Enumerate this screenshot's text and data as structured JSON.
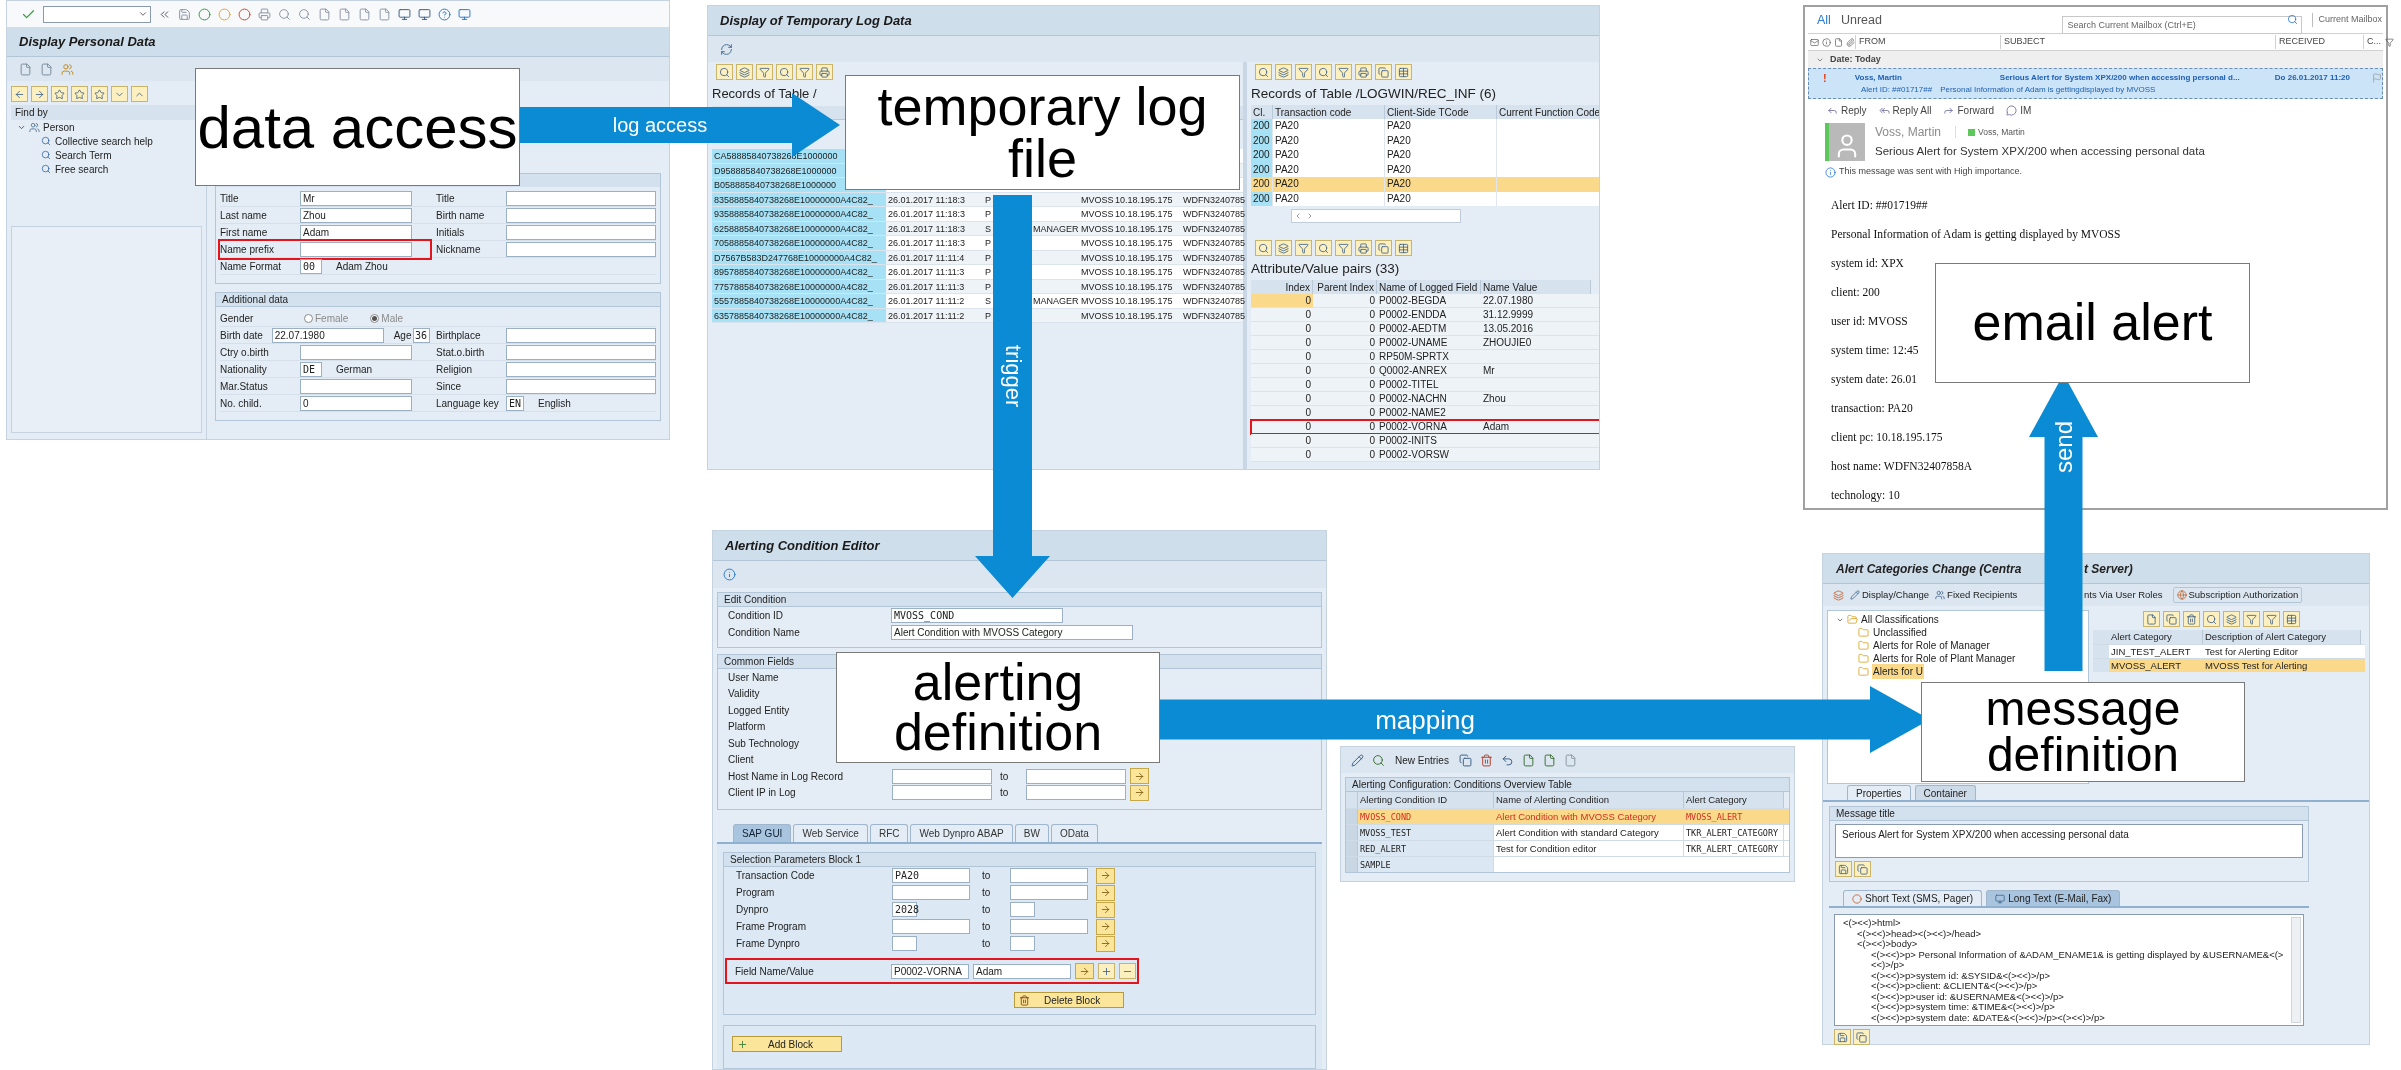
{
  "personal_data": {
    "title": "Display Personal Data",
    "find_by": "Find by",
    "tree": [
      {
        "label": "Person",
        "expanded": true,
        "children": [
          {
            "label": "Collective search help"
          },
          {
            "label": "Search Term"
          },
          {
            "label": "Free search"
          }
        ]
      }
    ],
    "name_rows": [
      {
        "left": {
          "label": "Title",
          "value": "Mr"
        },
        "right": {
          "label": "Title"
        },
        "marked": false
      },
      {
        "left": {
          "label": "Last name",
          "value": "Zhou"
        },
        "right": {
          "label": "Birth name"
        },
        "marked": false
      },
      {
        "left": {
          "label": "First name",
          "value": "Adam"
        },
        "right": {
          "label": "Initials"
        },
        "marked": false
      },
      {
        "left": {
          "label": "Name prefix"
        },
        "right": {
          "label": "Nickname"
        },
        "marked": true
      },
      {
        "left": {
          "label": "Name Format",
          "value": "00",
          "text": "Adam Zhou"
        },
        "marked": false
      }
    ],
    "additional_title": "Additional data",
    "additional_rows": [
      {
        "left": {
          "label": "Gender",
          "radios": [
            {
              "label": "Female",
              "selected": false
            },
            {
              "label": "Male",
              "selected": true
            }
          ]
        }
      },
      {
        "left": {
          "label": "Birth date",
          "value": "22.07.1980"
        },
        "extra": {
          "label": "Age",
          "value": "36"
        },
        "right": {
          "label": "Birthplace"
        }
      },
      {
        "left": {
          "label": "Ctry o.birth"
        },
        "right": {
          "label": "Stat.o.birth"
        }
      },
      {
        "left": {
          "label": "Nationality",
          "value": "DE",
          "text": "German"
        },
        "right": {
          "label": "Religion"
        }
      },
      {
        "left": {
          "label": "Mar.Status"
        },
        "right": {
          "label": "Since"
        }
      },
      {
        "left": {
          "label": "No. child.",
          "value": "0"
        },
        "right": {
          "label": "Language key",
          "value": "EN",
          "text": "English"
        }
      }
    ]
  },
  "log_data": {
    "title": "Display of Temporary Log Data",
    "records_title": "Records of Table /",
    "records": [
      {
        "column_1": "CA58885840738268E1000000"
      },
      {
        "column_1": "D958885840738268E1000000"
      },
      {
        "column_1": "B058885840738268E1000000"
      },
      {
        "column_1": "8358885840738268E10000000A4C82_",
        "column_2": "26.01.2017 11:18:3",
        "column_3": "P",
        "column_5": "MVOSS",
        "column_6": "10.18.195.175",
        "column_7": "WDFN3240785"
      },
      {
        "column_1": "9358885840738268E10000000A4C82_",
        "column_2": "26.01.2017 11:18:3",
        "column_3": "P",
        "column_5": "MVOSS",
        "column_6": "10.18.195.175",
        "column_7": "WDFN3240785"
      },
      {
        "column_1": "6258885840738268E10000000A4C82_",
        "column_2": "26.01.2017 11:18:3",
        "column_3": "S",
        "column_4": "MANAGER",
        "column_5": "MVOSS",
        "column_6": "10.18.195.175",
        "column_7": "WDFN3240785"
      },
      {
        "column_1": "7058885840738268E10000000A4C82_",
        "column_2": "26.01.2017 11:18:3",
        "column_3": "P",
        "column_5": "MVOSS",
        "column_6": "10.18.195.175",
        "column_7": "WDFN3240785"
      },
      {
        "column_1": "D7567B583D247768E10000000A4C82_",
        "column_2": "26.01.2017 11:11:4",
        "column_3": "P",
        "column_5": "MVOSS",
        "column_6": "10.18.195.175",
        "column_7": "WDFN3240785"
      },
      {
        "column_1": "8957885840738268E10000000A4C82_",
        "column_2": "26.01.2017 11:11:3",
        "column_3": "P",
        "column_5": "MVOSS",
        "column_6": "10.18.195.175",
        "column_7": "WDFN3240785"
      },
      {
        "column_1": "7757885840738268E10000000A4C82_",
        "column_2": "26.01.2017 11:11:3",
        "column_3": "P",
        "column_5": "MVOSS",
        "column_6": "10.18.195.175",
        "column_7": "WDFN3240785"
      },
      {
        "column_1": "5557885840738268E10000000A4C82_",
        "column_2": "26.01.2017 11:11:2",
        "column_3": "S",
        "column_4": "MANAGER",
        "column_5": "MVOSS",
        "column_6": "10.18.195.175",
        "column_7": "WDFN3240785"
      },
      {
        "column_1": "6357885840738268E10000000A4C82_",
        "column_2": "26.01.2017 11:11:2",
        "column_3": "P",
        "column_5": "MVOSS",
        "column_6": "10.18.195.175",
        "column_7": "WDFN3240785"
      }
    ],
    "inf_title": "Records of Table /LOGWIN/REC_INF (6)",
    "inf_columns": [
      "Cl.",
      "Transaction code",
      "Client-Side TCode",
      "Current Function Code"
    ],
    "inf_rows": [
      {
        "cells": [
          "200",
          "PA20",
          "PA20"
        ],
        "selected": false
      },
      {
        "cells": [
          "200",
          "PA20",
          "PA20"
        ],
        "selected": false
      },
      {
        "cells": [
          "200",
          "PA20",
          "PA20"
        ],
        "selected": false
      },
      {
        "cells": [
          "200",
          "PA20",
          "PA20"
        ],
        "selected": false
      },
      {
        "cells": [
          "200",
          "PA20",
          "PA20"
        ],
        "selected": true
      },
      {
        "cells": [
          "200",
          "PA20",
          "PA20"
        ],
        "selected": false
      }
    ],
    "pairs_title": "Attribute/Value pairs (33)",
    "pairs_columns": [
      "Index",
      "Parent Index",
      "Name of Logged Field",
      "Name Value"
    ],
    "pairs_rows": [
      {
        "cells": [
          "0",
          "0",
          "P0002-BEGDA",
          "22.07.1980"
        ],
        "selected": true,
        "marked": false
      },
      {
        "cells": [
          "0",
          "0",
          "P0002-ENDDA",
          "31.12.9999"
        ],
        "selected": false,
        "marked": false
      },
      {
        "cells": [
          "0",
          "0",
          "P0002-AEDTM",
          "13.05.2016"
        ],
        "selected": false,
        "marked": false
      },
      {
        "cells": [
          "0",
          "0",
          "P0002-UNAME",
          "ZHOUJIE0"
        ],
        "selected": false,
        "marked": false
      },
      {
        "cells": [
          "0",
          "0",
          "RP50M-SPRTX"
        ],
        "selected": false,
        "marked": false
      },
      {
        "cells": [
          "0",
          "0",
          "Q0002-ANREX",
          "Mr"
        ],
        "selected": false,
        "marked": false
      },
      {
        "cells": [
          "0",
          "0",
          "P0002-TITEL"
        ],
        "selected": false,
        "marked": false
      },
      {
        "cells": [
          "0",
          "0",
          "P0002-NACHN",
          "Zhou"
        ],
        "selected": false,
        "marked": false
      },
      {
        "cells": [
          "0",
          "0",
          "P0002-NAME2"
        ],
        "selected": false,
        "marked": false
      },
      {
        "cells": [
          "0",
          "0",
          "P0002-VORNA",
          "Adam"
        ],
        "selected": false,
        "marked": true
      },
      {
        "cells": [
          "0",
          "0",
          "P0002-INITS"
        ],
        "selected": false,
        "marked": false
      },
      {
        "cells": [
          "0",
          "0",
          "P0002-VORSW"
        ],
        "selected": false,
        "marked": false
      }
    ]
  },
  "email": {
    "filters": [
      {
        "label": "All",
        "selected": true
      },
      {
        "label": "Unread",
        "selected": false
      }
    ],
    "search": {
      "placeholder": "Search Current Mailbox (Ctrl+E)"
    },
    "scope": "Current Mailbox",
    "columns": [
      "FROM",
      "SUBJECT",
      "RECEIVED",
      "C..."
    ],
    "group": "Date: Today",
    "message": {
      "importance": "!",
      "from": "Voss, Martin",
      "subject": "Serious Alert for System XPX/200 when accessing personal d...",
      "received": "Do 26.01.2017 11:20",
      "preview_id": "Alert ID: ##01717##",
      "preview": "Personal Information of Adam is gettingdisplayed by MVOSS",
      "selected": true
    },
    "actions": [
      "Reply",
      "Reply All",
      "Forward",
      "IM"
    ],
    "sender": "Voss, Martin",
    "contact": "Voss, Martin",
    "subject": "Serious Alert for System XPX/200 when accessing personal data",
    "notice": "This message was sent with High importance.",
    "body": [
      "Alert ID: ##01719##",
      "Personal Information of Adam is getting displayed by MVOSS",
      "system id: XPX",
      "client: 200",
      "user id: MVOSS",
      "system time: 12:45",
      "system date: 26.01",
      "transaction: PA20",
      "client pc: 10.18.195.175",
      "host name: WDFN32407858A",
      "technology: 10"
    ]
  },
  "condition_editor": {
    "title": "Alerting Condition Editor",
    "edit_group": {
      "title": "Edit Condition",
      "rows": [
        {
          "label": "Condition ID",
          "value": "MVOSS_COND"
        },
        {
          "label": "Condition Name",
          "value": "Alert Condition with MVOSS Category"
        }
      ]
    },
    "common_group": {
      "title": "Common Fields",
      "rows": [
        {
          "label": "User Name"
        },
        {
          "label": "Validity"
        },
        {
          "label": "Logged Entity"
        },
        {
          "label": "Platform"
        },
        {
          "label": "Sub Technology"
        },
        {
          "label": "Client"
        },
        {
          "label": "Host Name in Log Record",
          "to": "to"
        },
        {
          "label": "Client IP in Log",
          "to": "to"
        }
      ]
    },
    "tabs": [
      {
        "label": "SAP GUI",
        "selected": true
      },
      {
        "label": "Web Service",
        "selected": false
      },
      {
        "label": "RFC",
        "selected": false
      },
      {
        "label": "Web Dynpro ABAP",
        "selected": false
      },
      {
        "label": "BW",
        "selected": false
      },
      {
        "label": "OData",
        "selected": false
      }
    ],
    "selection_group": {
      "title": "Selection Parameters Block 1",
      "rows": [
        {
          "label": "Transaction Code",
          "value": "PA20",
          "to": "to"
        },
        {
          "label": "Program",
          "to": "to"
        },
        {
          "label": "Dynpro",
          "value": "2028",
          "to": "to"
        },
        {
          "label": "Frame Program",
          "to": "to"
        },
        {
          "label": "Frame Dynpro",
          "to": "to"
        }
      ],
      "field_row": {
        "label": "Field Name/Value",
        "name": "P0002-VORNA",
        "value": "Adam",
        "marked": true
      }
    },
    "delete_button": "Delete Block",
    "add_button": "Add Block"
  },
  "conditions_table": {
    "toolbar_button": "New Entries",
    "group": "Alerting Configuration: Conditions Overview Table",
    "columns": [
      "Alerting Condition ID",
      "Name of Alerting Condition",
      "Alert Category"
    ],
    "rows": [
      {
        "cells": [
          "MVOSS_COND",
          "Alert Condition with MVOSS Category",
          "MVOSS_ALERT"
        ],
        "selected": true
      },
      {
        "cells": [
          "MVOSS_TEST",
          "Alert Condition with standard Category",
          "TKR_ALERT_CATEGORY"
        ],
        "selected": false
      },
      {
        "cells": [
          "RED_ALERT",
          "Test for Condition editor",
          "TKR_ALERT_CATEGORY"
        ],
        "selected": false
      },
      {
        "cells": [
          "SAMPLE"
        ],
        "selected": false
      }
    ]
  },
  "alert_categories": {
    "title_start": "Alert Categories Change (Centra",
    "title_end": "t Server)",
    "toolbar": [
      "Display/Change",
      "Fixed Recipients",
      "nts Via User Roles",
      "Subscription Authorization"
    ],
    "tree": {
      "label": "All Classifications",
      "expanded": true,
      "children": [
        {
          "label": "Unclassified",
          "selected": false
        },
        {
          "label": "Alerts for Role of Manager",
          "selected": false
        },
        {
          "label": "Alerts for Role of Plant Manager",
          "selected": false
        },
        {
          "label": "Alerts for U",
          "selected": true
        }
      ]
    },
    "columns": [
      "Alert Category",
      "Description of Alert Category"
    ],
    "rows": [
      {
        "cells": [
          "JIN_TEST_ALERT",
          "Test for Alerting Editor"
        ],
        "selected": false
      },
      {
        "cells": [
          "MVOSS_ALERT",
          "MVOSS Test for Alerting"
        ],
        "selected": true
      }
    ],
    "tabs": [
      {
        "label": "Properties",
        "selected": true
      },
      {
        "label": "Container",
        "selected": false
      }
    ],
    "message_title_label": "Message title",
    "message_title": "Serious Alert for System XPX/200 when accessing personal data",
    "text_tabs": [
      {
        "label": "Short Text (SMS, Pager)",
        "selected": false
      },
      {
        "label": "Long Text (E-Mail, Fax)",
        "selected": true
      }
    ],
    "long_text": [
      {
        "text": "<(><<)>html>",
        "children": [
          {
            "text": "<(><<)>head><(><<)>/head>"
          },
          {
            "text": "<(><<)>body>",
            "children": [
              {
                "text": "<(><<)>p> Personal Information of &ADAM_ENAME1& is getting displayed by &USERNAME&<(><<)>/p>"
              },
              {
                "text": "<(><<)>p>system id: &SYSID&<(><<)>/p>"
              },
              {
                "text": "<(><<)>p>client: &CLIENT&<(><<)>/p>"
              },
              {
                "text": "<(><<)>p>user id: &USERNAME&<(><<)>/p>"
              },
              {
                "text": "<(><<)>p>system time: &TIME&<(><<)>/p>"
              },
              {
                "text": "<(><<)>p>system date: &DATE&<(><<)>/p><(><<)>/p>"
              }
            ]
          }
        ]
      }
    ]
  },
  "captions": [
    {
      "text": "data access"
    },
    {
      "text": "temporary log file"
    },
    {
      "text": "email alert"
    },
    {
      "text": "alerting definition"
    },
    {
      "text": "message definition"
    }
  ],
  "arrows": [
    {
      "label": "log access",
      "kind": "right"
    },
    {
      "label": "trigger",
      "kind": "down"
    },
    {
      "label": "send",
      "kind": "up"
    },
    {
      "label": "mapping",
      "kind": "right"
    }
  ]
}
